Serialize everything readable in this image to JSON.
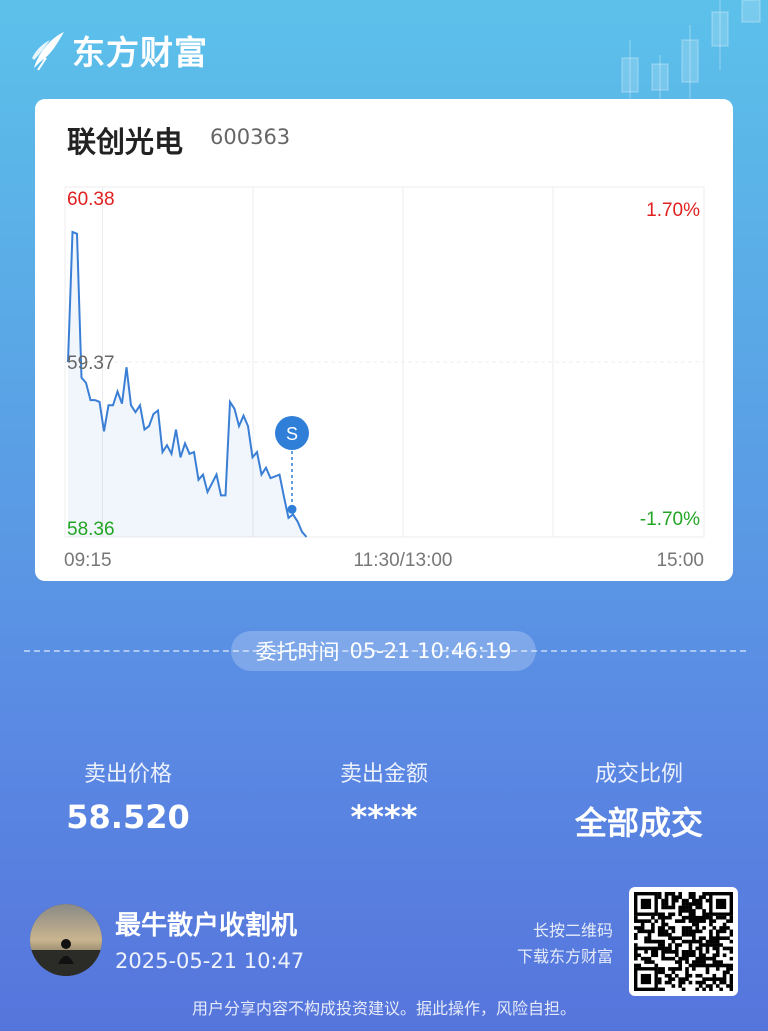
{
  "brand": {
    "name": "东方财富"
  },
  "stock": {
    "name": "联创光电",
    "code": "600363"
  },
  "chart_data": {
    "type": "line",
    "title": "",
    "y_top": "60.38",
    "y_mid": "59.37",
    "y_bottom": "58.36",
    "pct_top": "1.70%",
    "pct_bottom": "-1.70%",
    "x_labels": [
      "09:15",
      "11:30/13:00",
      "15:00"
    ],
    "ylim": [
      58.36,
      60.38
    ],
    "prev_close": 59.37,
    "series": [
      {
        "values": [
          59.37,
          60.12,
          60.11,
          59.28,
          59.25,
          59.15,
          59.15,
          59.14,
          58.97,
          59.12,
          59.12,
          59.2,
          59.13,
          59.34,
          59.12,
          59.08,
          59.12,
          58.98,
          59.0,
          59.07,
          59.09,
          58.85,
          58.89,
          58.84,
          58.98,
          58.82,
          58.9,
          58.84,
          58.85,
          58.69,
          58.72,
          58.62,
          58.67,
          58.72,
          58.6,
          58.6,
          59.14,
          59.1,
          59.0,
          59.06,
          59.0,
          58.82,
          58.85,
          58.72,
          58.76,
          58.7,
          58.71,
          58.72,
          58.59,
          58.47,
          58.49,
          58.45,
          58.39,
          58.36
        ]
      }
    ],
    "trade_marker": {
      "label": "S",
      "price": 58.52
    }
  },
  "order": {
    "label": "委托时间",
    "time": "05-21 10:46:19"
  },
  "stats": [
    {
      "label": "卖出价格",
      "value": "58.520"
    },
    {
      "label": "卖出金额",
      "value": "****"
    },
    {
      "label": "成交比例",
      "value": "全部成交"
    }
  ],
  "user": {
    "name": "最牛散户收割机",
    "time": "2025-05-21 10:47"
  },
  "qr_hint": {
    "line1": "长按二维码",
    "line2": "下载东方财富"
  },
  "disclaimer": "用户分享内容不构成投资建议。据此操作，风险自担。",
  "colors": {
    "up": "#e02020",
    "down": "#23a524",
    "line": "#3a7fd5",
    "marker": "#2f7fd9"
  }
}
